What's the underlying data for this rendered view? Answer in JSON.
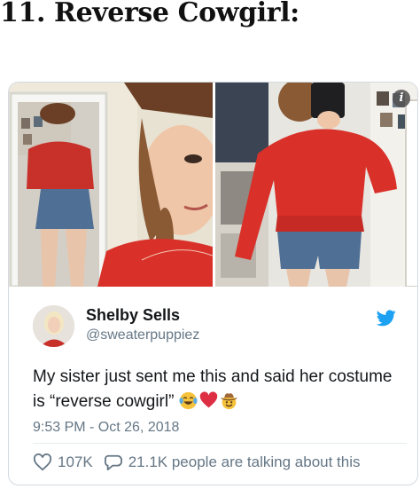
{
  "article": {
    "heading": "11. Reverse Cowgirl:"
  },
  "tweet": {
    "display_name": "Shelby Sells",
    "handle": "@sweaterpuppiez",
    "text": "My sister just sent me this and said her costume is “reverse cowgirl”",
    "emojis": [
      "face-with-tears-of-joy-emoji",
      "red-heart-emoji",
      "cowboy-hat-face-emoji"
    ],
    "timestamp": "9:53 PM - Oct 26, 2018",
    "likes": "107K",
    "replies_text": "21.1K people are talking about this",
    "info_glyph": "i"
  },
  "colors": {
    "twitter_blue": "#1da1f2",
    "muted": "#657786",
    "text": "#14171a",
    "jacket_red": "#d9312a"
  }
}
